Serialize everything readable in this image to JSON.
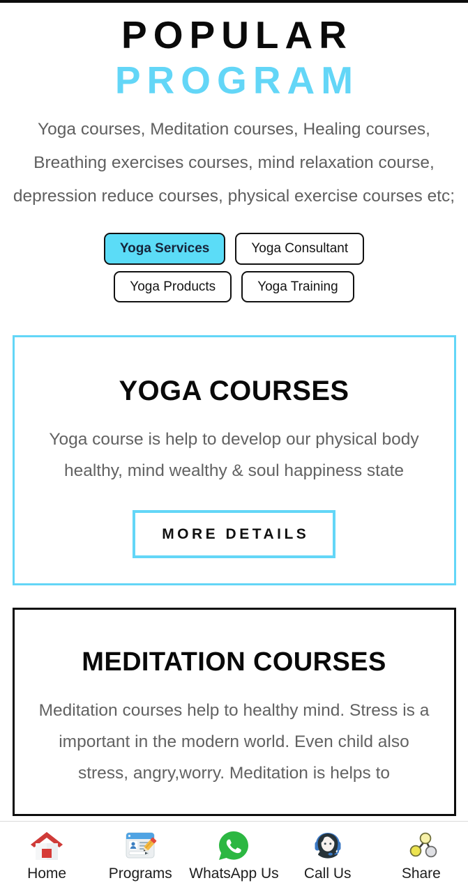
{
  "page": {
    "heading_line_1": "POPULAR",
    "heading_line_2": "PROGRAM",
    "intro": "Yoga courses, Meditation courses, Healing courses, Breathing exercises courses, mind relaxation course, depression reduce courses, physical exercise courses etc;"
  },
  "colors": {
    "accent_cyan": "#63d6f7",
    "active_tab_bg": "#5bdcf7",
    "heading_dark": "#0a0a0a",
    "body_text": "#5f5f5f",
    "card_border_dark": "#0d0d0d"
  },
  "tabs": [
    {
      "label": "Yoga Services",
      "active": true
    },
    {
      "label": "Yoga Consultant",
      "active": false
    },
    {
      "label": "Yoga Products",
      "active": false
    },
    {
      "label": "Yoga Training",
      "active": false
    }
  ],
  "cards": [
    {
      "title": "YOGA COURSES",
      "description": "Yoga course is help to develop our physical body healthy, mind wealthy & soul happiness state",
      "cta_label": "MORE DETAILS",
      "border_color": "#63d6f7"
    },
    {
      "title": "MEDITATION COURSES",
      "description": "Meditation courses help to healthy mind. Stress is a important in the modern world. Even child also stress, angry,worry. Meditation is helps to",
      "border_color": "#0d0d0d"
    }
  ],
  "bottom_nav": [
    {
      "label": "Home",
      "icon": "home-icon"
    },
    {
      "label": "Programs",
      "icon": "programs-form-icon"
    },
    {
      "label": "WhatsApp Us",
      "icon": "whatsapp-icon"
    },
    {
      "label": "Call Us",
      "icon": "support-agent-icon"
    },
    {
      "label": "Share",
      "icon": "share-nodes-icon"
    }
  ]
}
